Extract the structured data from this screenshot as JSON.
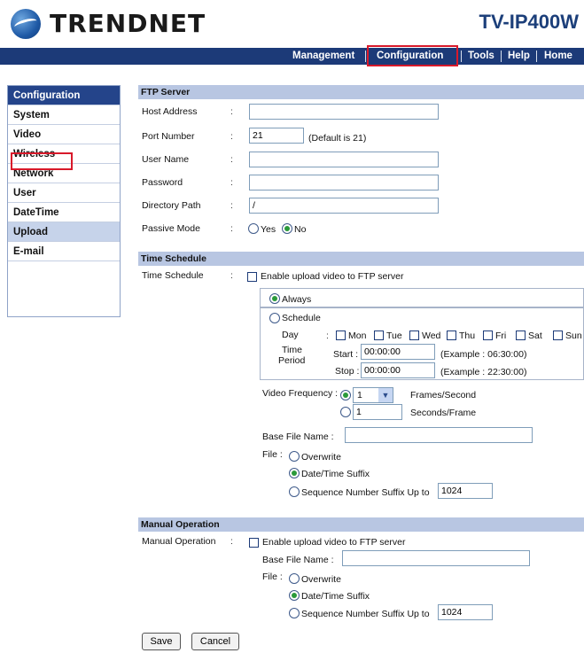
{
  "header": {
    "brand": "TRENDnet",
    "brand_display": "TRENDNET",
    "model": "TV-IP400W"
  },
  "nav": {
    "management": "Management",
    "configuration": "Configuration",
    "tools": "Tools",
    "help": "Help",
    "home": "Home"
  },
  "sidebar": {
    "items": [
      {
        "label": "Configuration"
      },
      {
        "label": "System"
      },
      {
        "label": "Video"
      },
      {
        "label": "Wireless"
      },
      {
        "label": "Network"
      },
      {
        "label": "User"
      },
      {
        "label": "DateTime"
      },
      {
        "label": "Upload"
      },
      {
        "label": "E-mail"
      }
    ]
  },
  "ftp": {
    "title": "FTP Server",
    "host_label": "Host Address",
    "host_value": "",
    "port_label": "Port Number",
    "port_value": "21",
    "port_hint": "(Default is 21)",
    "user_label": "User Name",
    "user_value": "",
    "password_label": "Password",
    "password_value": "",
    "dir_label": "Directory Path",
    "dir_value": "/",
    "passive_label": "Passive Mode",
    "passive_yes": "Yes",
    "passive_no": "No",
    "passive_selected": "No"
  },
  "schedule": {
    "title": "Time Schedule",
    "label": "Time Schedule",
    "enable_label": "Enable upload video to FTP server",
    "enable_checked": false,
    "always_label": "Always",
    "schedule_label": "Schedule",
    "mode_selected": "Always",
    "day_label": "Day",
    "days": [
      "Mon",
      "Tue",
      "Wed",
      "Thu",
      "Fri",
      "Sat",
      "Sun"
    ],
    "time_label": "Time",
    "period_label": "Period",
    "start_label": "Start :",
    "start_value": "00:00:00",
    "start_example": "(Example : 06:30:00)",
    "stop_label": "Stop :",
    "stop_value": "00:00:00",
    "stop_example": "(Example : 22:30:00)",
    "freq_label": "Video Frequency :",
    "fps_value": "1",
    "fps_unit": "Frames/Second",
    "spf_value": "1",
    "spf_unit": "Seconds/Frame",
    "base_label": "Base File Name :",
    "base_value": "",
    "file_label": "File :",
    "overwrite_label": "Overwrite",
    "datetime_label": "Date/Time Suffix",
    "seq_label": "Sequence Number Suffix Up to",
    "seq_value": "1024",
    "file_selected": "Date/Time Suffix"
  },
  "manual": {
    "title": "Manual Operation",
    "label": "Manual Operation",
    "enable_label": "Enable upload video to FTP server",
    "enable_checked": false,
    "base_label": "Base File Name :",
    "base_value": "",
    "file_label": "File :",
    "overwrite_label": "Overwrite",
    "datetime_label": "Date/Time Suffix",
    "seq_label": "Sequence Number Suffix Up to",
    "seq_value": "1024",
    "file_selected": "Date/Time Suffix"
  },
  "buttons": {
    "save": "Save",
    "cancel": "Cancel"
  },
  "colors": {
    "nav_bg": "#1c3a78",
    "section_bg": "#b8c6e2",
    "highlight": "#d8192a",
    "radio_on": "#2a9a3a"
  }
}
